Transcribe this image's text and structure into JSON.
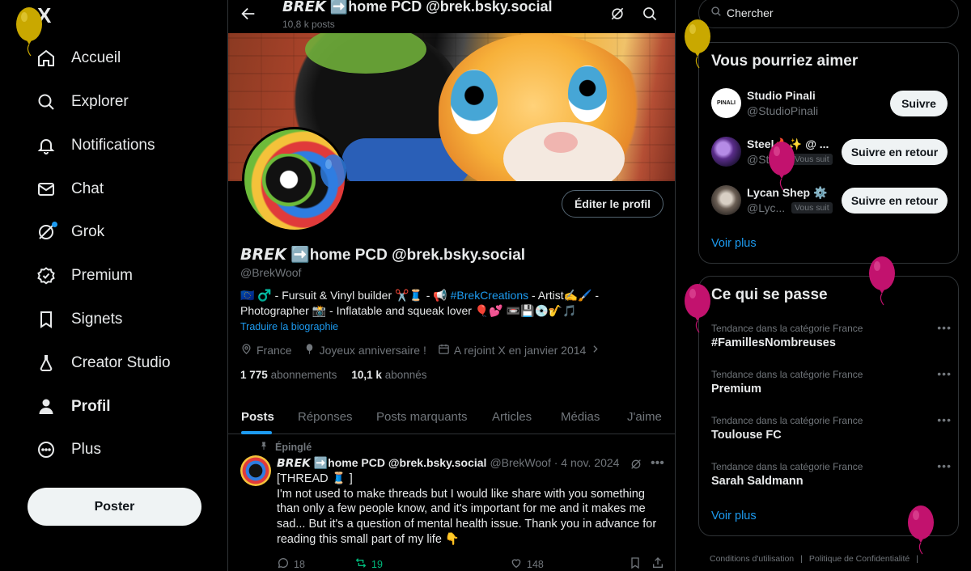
{
  "logo": "X",
  "nav": {
    "items": [
      {
        "label": "Accueil"
      },
      {
        "label": "Explorer"
      },
      {
        "label": "Notifications"
      },
      {
        "label": "Chat"
      },
      {
        "label": "Grok"
      },
      {
        "label": "Premium"
      },
      {
        "label": "Signets"
      },
      {
        "label": "Creator Studio"
      },
      {
        "label": "Profil"
      },
      {
        "label": "Plus"
      }
    ],
    "post_label": "Poster"
  },
  "header": {
    "title": "𝘽𝙍𝙀𝙆 ➡️home PCD @brek.bsky.social",
    "subtitle": "10,8 k posts"
  },
  "profile": {
    "edit_label": "Éditer le profil",
    "name": "𝘽𝙍𝙀𝙆 ➡️home PCD @brek.bsky.social",
    "handle": "@BrekWoof",
    "bio_line1_a": "🇪🇺 ♂️ - Fursuit & Vinyl builder ✂️🧵 - 📢 ",
    "bio_hashtag": "#BrekCreations",
    "bio_line1_b": " - Artist✍️🖌️ -",
    "bio_line2": "Photographer 📸 - Inflatable and squeak lover 🎈💕 📼💾💿🎷🎵",
    "translate": "Traduire la biographie",
    "location": "France",
    "birthday": "Joyeux anniversaire !",
    "joined": "A rejoint X en janvier 2014",
    "following_count": "1 775",
    "following_label": "abonnements",
    "followers_count": "10,1 k",
    "followers_label": "abonnés"
  },
  "tabs": [
    {
      "label": "Posts"
    },
    {
      "label": "Réponses"
    },
    {
      "label": "Posts marquants"
    },
    {
      "label": "Articles"
    },
    {
      "label": "Médias"
    },
    {
      "label": "J'aime"
    }
  ],
  "tweet": {
    "pinned": "Épinglé",
    "author": "𝘽𝙍𝙀𝙆 ➡️home PCD @brek.bsky.social",
    "handle_date": "@BrekWoof · 4 nov. 2024",
    "line1": "[THREAD 🧵 ]",
    "body": "I'm not used to make threads but I would like share with you something than only a few people know, and it's important for me and it makes me sad... But it's a question of mental health issue. Thank you in advance for reading this small part of my life 👇",
    "replies": "18",
    "retweets": "19",
    "likes": "148"
  },
  "right": {
    "search_placeholder": "Chercher",
    "suggest_title": "Vous pourriez aimer",
    "suggestions": [
      {
        "name": "Studio Pinali",
        "handle": "@StudioPinali",
        "badge": "",
        "button": "Suivre"
      },
      {
        "name": "Steel🔥✨ @ ...",
        "handle": "@Ste...",
        "badge": "Vous suit",
        "button": "Suivre en retour"
      },
      {
        "name": "Lycan Shep ⚙️",
        "handle": "@Lyc...",
        "badge": "Vous suit",
        "button": "Suivre en retour"
      }
    ],
    "see_more": "Voir plus",
    "trends_title": "Ce qui se passe",
    "trends": [
      {
        "category": "Tendance dans la catégorie France",
        "name": "#FamillesNombreuses"
      },
      {
        "category": "Tendance dans la catégorie France",
        "name": "Premium"
      },
      {
        "category": "Tendance dans la catégorie France",
        "name": "Toulouse FC"
      },
      {
        "category": "Tendance dans la catégorie France",
        "name": "Sarah Saldmann"
      }
    ],
    "trends_see_more": "Voir plus",
    "footer_terms": "Conditions d'utilisation",
    "footer_privacy": "Politique de Confidentialité"
  },
  "colors": {
    "accent": "#1d9bf0",
    "retweet": "#00ba7c",
    "balloon_gold": "#c9a800",
    "balloon_pink": "#c2126e"
  }
}
